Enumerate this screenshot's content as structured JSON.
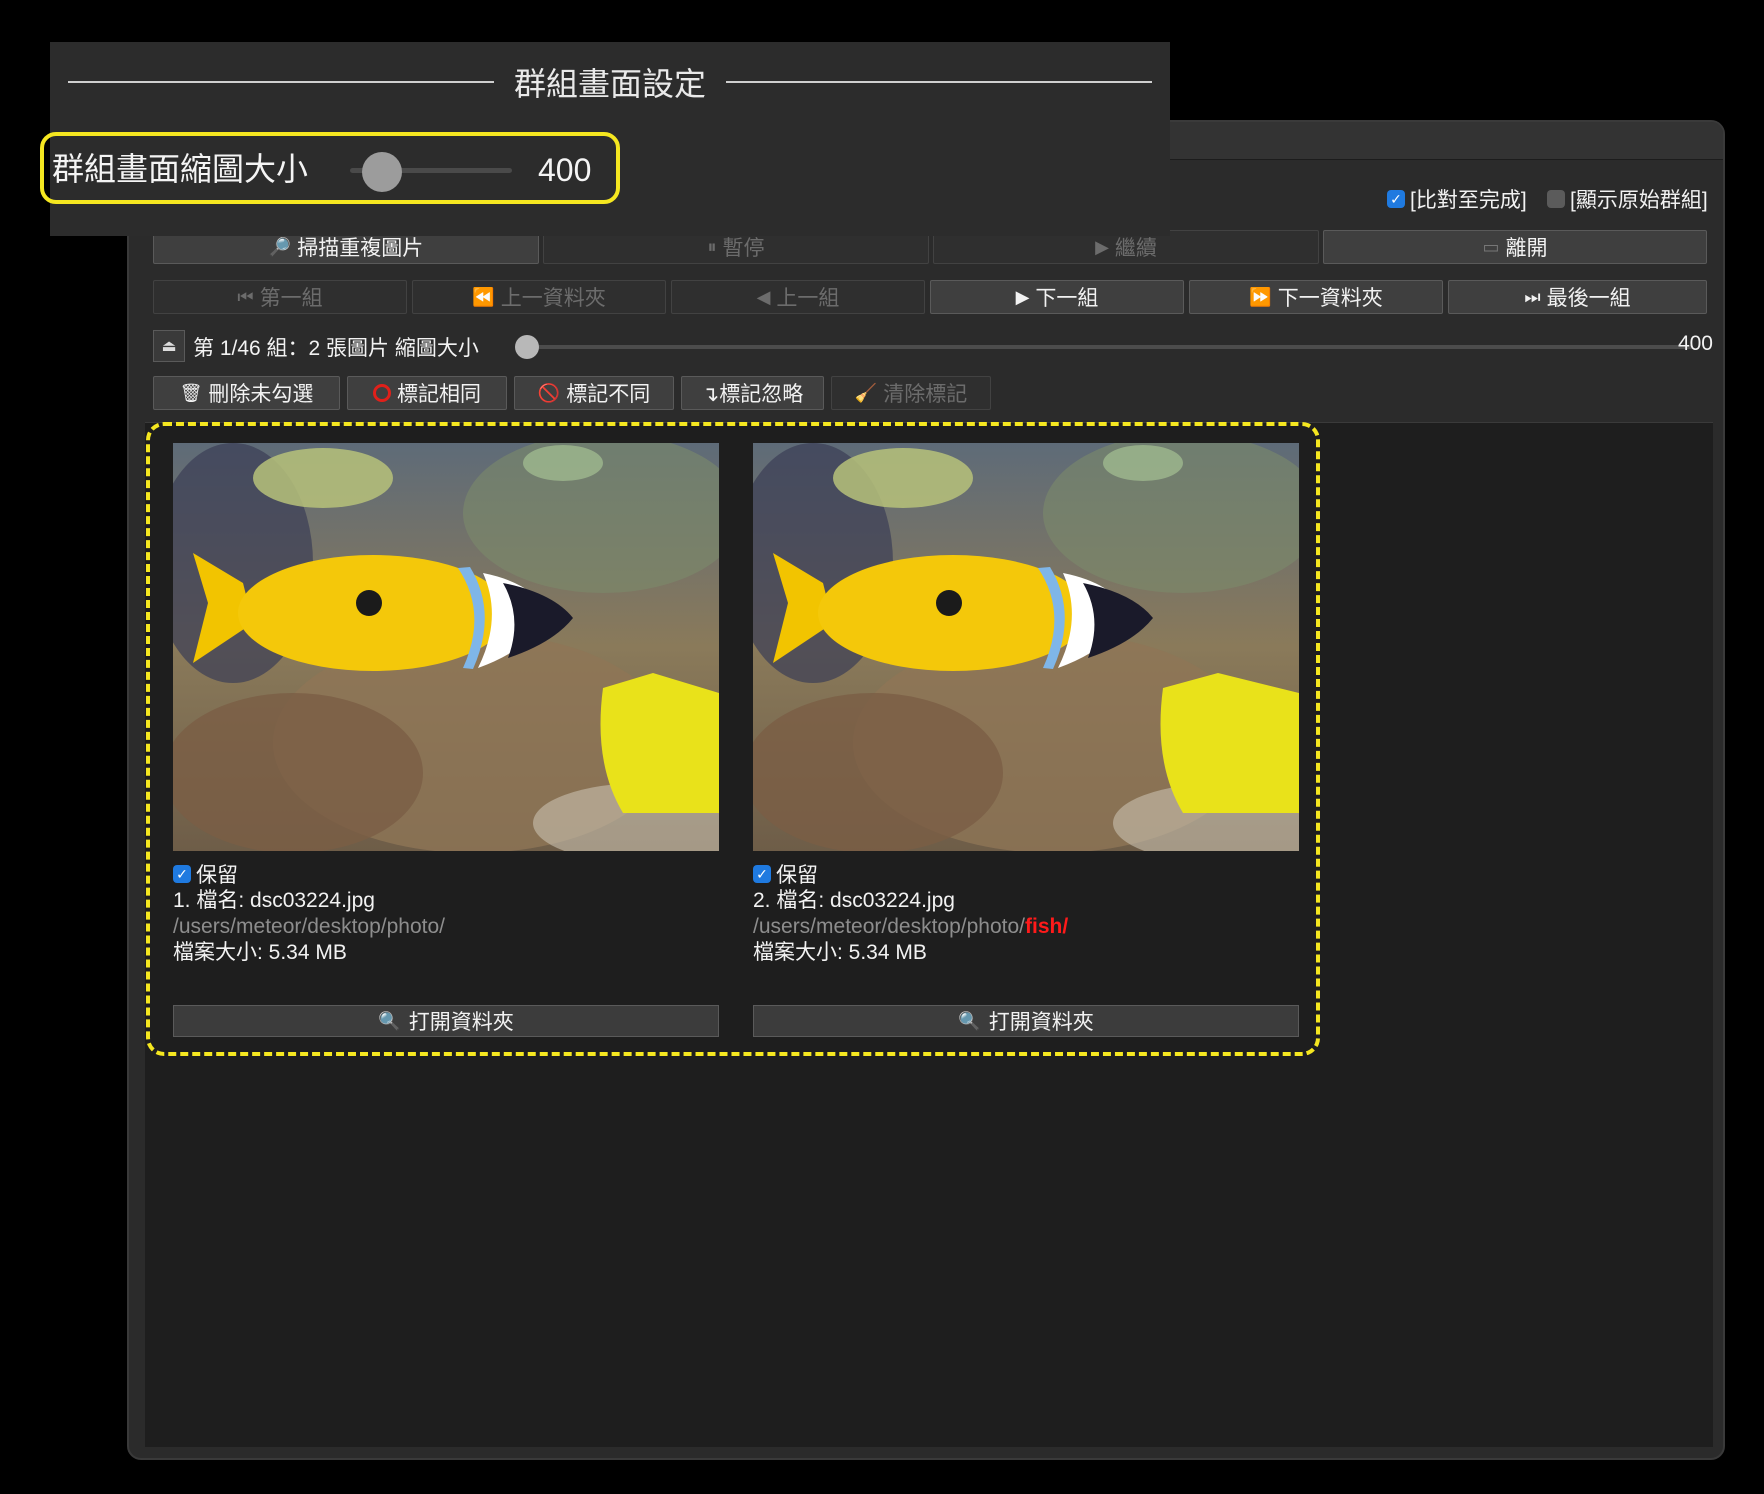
{
  "overlay": {
    "title": "群組畫面設定",
    "thumb_label": "群組畫面縮圖大小",
    "thumb_value": "400",
    "thumb_level": 0.1
  },
  "options": [
    {
      "label": "[比對至完成]",
      "checked": true
    },
    {
      "label": "[顯示原始群組]",
      "checked": false
    }
  ],
  "toolbar": {
    "scan": {
      "label": "掃描重複圖片",
      "icon": "magnifier-icon",
      "enabled": true
    },
    "pause": {
      "label": "暫停",
      "icon": "pause-icon",
      "enabled": false
    },
    "resume": {
      "label": "繼續",
      "icon": "play-icon",
      "enabled": false
    },
    "exit": {
      "label": "離開",
      "icon": "exit-icon",
      "enabled": true
    }
  },
  "nav": [
    {
      "label": "第一組",
      "icon": "⏮",
      "enabled": false
    },
    {
      "label": "上一資料夾",
      "icon": "⏪",
      "enabled": false
    },
    {
      "label": "上一組",
      "icon": "◀",
      "enabled": false
    },
    {
      "label": "下一組",
      "icon": "▶",
      "enabled": true
    },
    {
      "label": "下一資料夾",
      "icon": "⏩",
      "enabled": true
    },
    {
      "label": "最後一組",
      "icon": "⏭",
      "enabled": true
    }
  ],
  "status": {
    "text": "第 1/46 組：2 張圖片 縮圖大小",
    "size_value": "400",
    "size_level": 0.0
  },
  "actions": [
    {
      "label": "刪除未勾選",
      "icon": "trash-icon",
      "enabled": true
    },
    {
      "label": "標記相同",
      "icon": "circle-icon",
      "enabled": true
    },
    {
      "label": "標記不同",
      "icon": "prohibited-icon",
      "enabled": true
    },
    {
      "label": "↴標記忽略",
      "icon": "",
      "enabled": true
    },
    {
      "label": "清除標記",
      "icon": "broom-icon",
      "enabled": false
    }
  ],
  "photos": [
    {
      "keep_label": "保留",
      "keep": true,
      "name": "1. 檔名: dsc03224.jpg",
      "path": "/users/meteor/desktop/photo/",
      "path_extra": "",
      "size": "檔案大小: 5.34 MB",
      "open_label": "打開資料夾"
    },
    {
      "keep_label": "保留",
      "keep": true,
      "name": "2. 檔名: dsc03224.jpg",
      "path": "/users/meteor/desktop/photo/",
      "path_extra": "fish/",
      "size": "檔案大小: 5.34 MB",
      "open_label": "打開資料夾"
    }
  ],
  "colors": {
    "accent_highlight": "#f5e720",
    "checkbox": "#1f7ae0",
    "path_highlight": "#ff1a1a"
  }
}
